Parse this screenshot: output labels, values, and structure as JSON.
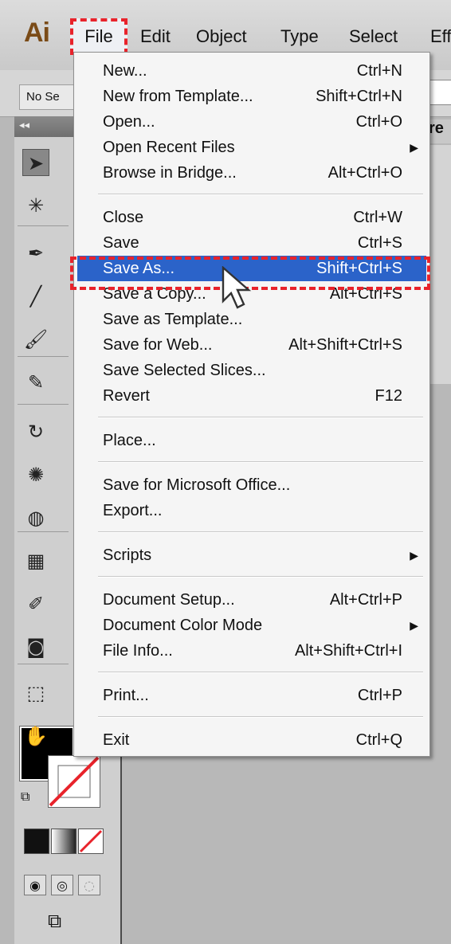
{
  "app": {
    "logo": "Ai",
    "menus": [
      "File",
      "Edit",
      "Object",
      "Type",
      "Select",
      "Eff"
    ],
    "control_bar_text": "No Se",
    "right_panel_tab": "re",
    "panel_collapse": "◂◂"
  },
  "file_menu": {
    "items": [
      {
        "label": "New...",
        "shortcut": "Ctrl+N"
      },
      {
        "label": "New from Template...",
        "shortcut": "Shift+Ctrl+N"
      },
      {
        "label": "Open...",
        "shortcut": "Ctrl+O"
      },
      {
        "label": "Open Recent Files",
        "shortcut": "",
        "submenu": true
      },
      {
        "label": "Browse in Bridge...",
        "shortcut": "Alt+Ctrl+O"
      },
      {
        "label": "Close",
        "shortcut": "Ctrl+W"
      },
      {
        "label": "Save",
        "shortcut": "Ctrl+S"
      },
      {
        "label": "Save As...",
        "shortcut": "Shift+Ctrl+S",
        "highlighted": true
      },
      {
        "label": "Save a Copy...",
        "shortcut": "Alt+Ctrl+S"
      },
      {
        "label": "Save as Template...",
        "shortcut": ""
      },
      {
        "label": "Save for Web...",
        "shortcut": "Alt+Shift+Ctrl+S"
      },
      {
        "label": "Save Selected Slices...",
        "shortcut": ""
      },
      {
        "label": "Revert",
        "shortcut": "F12"
      },
      {
        "label": "Place...",
        "shortcut": ""
      },
      {
        "label": "Save for Microsoft Office...",
        "shortcut": ""
      },
      {
        "label": "Export...",
        "shortcut": ""
      },
      {
        "label": "Scripts",
        "shortcut": "",
        "submenu": true
      },
      {
        "label": "Document Setup...",
        "shortcut": "Alt+Ctrl+P"
      },
      {
        "label": "Document Color Mode",
        "shortcut": "",
        "submenu": true
      },
      {
        "label": "File Info...",
        "shortcut": "Alt+Shift+Ctrl+I"
      },
      {
        "label": "Print...",
        "shortcut": "Ctrl+P"
      },
      {
        "label": "Exit",
        "shortcut": "Ctrl+Q"
      }
    ]
  },
  "tools": [
    {
      "name": "selection-tool-icon",
      "glyph": "➤",
      "selected": true
    },
    {
      "name": "magic-wand-tool-icon",
      "glyph": "✳"
    },
    {
      "name": "pen-tool-icon",
      "glyph": "✒"
    },
    {
      "name": "line-tool-icon",
      "glyph": "╱"
    },
    {
      "name": "paintbrush-tool-icon",
      "glyph": "🖌"
    },
    {
      "name": "blob-brush-tool-icon",
      "glyph": "✎"
    },
    {
      "name": "rotate-tool-icon",
      "glyph": "↻"
    },
    {
      "name": "warp-tool-icon",
      "glyph": "✺"
    },
    {
      "name": "shape-builder-tool-icon",
      "glyph": "◍"
    },
    {
      "name": "mesh-tool-icon",
      "glyph": "▦"
    },
    {
      "name": "eyedropper-tool-icon",
      "glyph": "✐"
    },
    {
      "name": "symbol-sprayer-tool-icon",
      "glyph": "◙"
    },
    {
      "name": "artboard-tool-icon",
      "glyph": "⬚"
    },
    {
      "name": "hand-tool-icon",
      "glyph": "✋"
    }
  ],
  "colors": {
    "highlight": "#2b63c9",
    "annotation": "#e8232b",
    "logo": "#7a4b17"
  }
}
